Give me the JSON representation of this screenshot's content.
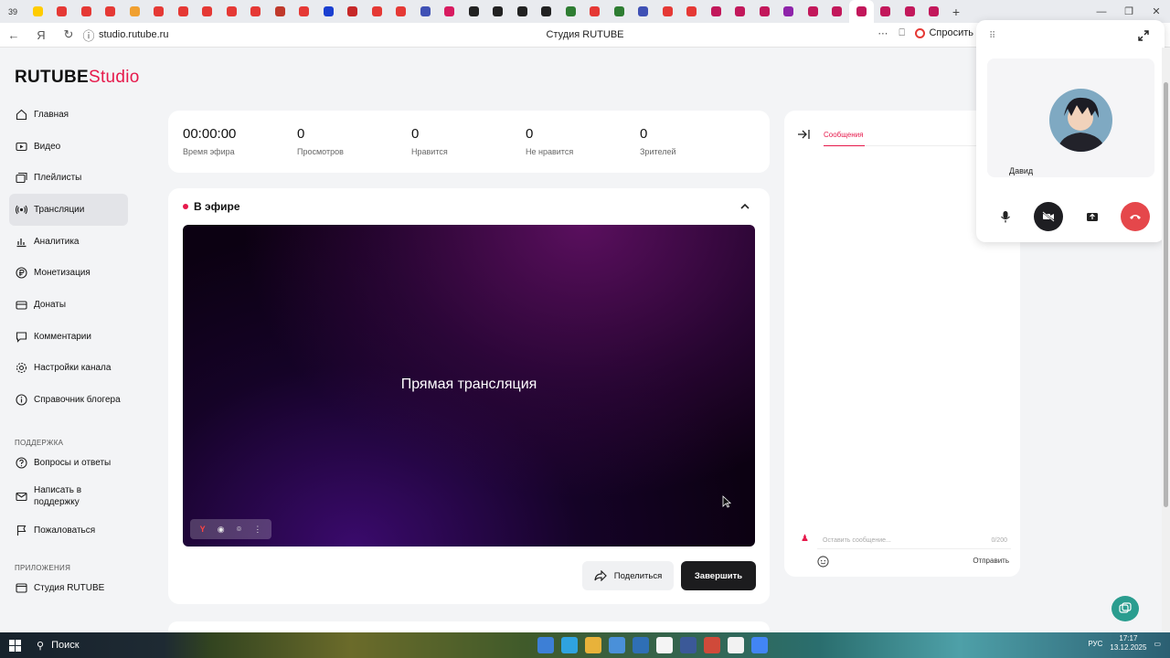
{
  "browser": {
    "tab_count": "39",
    "url": "studio.rutube.ru",
    "title": "Студия RUTUBE",
    "ask_label": "Спросить"
  },
  "logo": {
    "brand": "RUTUBE",
    "product": "Studio"
  },
  "sidebar": {
    "items": [
      {
        "label": "Главная",
        "icon": "home-icon"
      },
      {
        "label": "Видео",
        "icon": "video-icon"
      },
      {
        "label": "Плейлисты",
        "icon": "playlist-icon"
      },
      {
        "label": "Трансляции",
        "icon": "broadcast-icon",
        "active": true
      },
      {
        "label": "Аналитика",
        "icon": "analytics-icon"
      },
      {
        "label": "Монетизация",
        "icon": "ruble-icon"
      },
      {
        "label": "Донаты",
        "icon": "donation-icon"
      },
      {
        "label": "Комментарии",
        "icon": "comment-icon"
      },
      {
        "label": "Настройки канала",
        "icon": "gear-icon"
      },
      {
        "label": "Справочник блогера",
        "icon": "info-icon"
      }
    ],
    "support_title": "ПОДДЕРЖКА",
    "support_items": [
      {
        "label": "Вопросы и ответы",
        "icon": "question-icon"
      },
      {
        "label": "Написать в поддержку",
        "icon": "mail-icon"
      },
      {
        "label": "Пожаловаться",
        "icon": "flag-icon"
      }
    ],
    "apps_title": "ПРИЛОЖЕНИЯ",
    "apps_items": [
      {
        "label": "Студия RUTUBE",
        "icon": "app-icon"
      }
    ]
  },
  "stats": [
    {
      "value": "00:00:00",
      "label": "Время эфира"
    },
    {
      "value": "0",
      "label": "Просмотров"
    },
    {
      "value": "0",
      "label": "Нравится"
    },
    {
      "value": "0",
      "label": "Не нравится"
    },
    {
      "value": "0",
      "label": "Зрителей"
    }
  ],
  "live": {
    "status": "В эфире",
    "player_text": "Прямая трансляция",
    "share_label": "Поделиться",
    "end_label": "Завершить"
  },
  "chat": {
    "tab_messages": "Сообщения",
    "input_placeholder": "Оставить сообщение...",
    "char_count": "0/200",
    "send_label": "Отправить"
  },
  "call": {
    "caller_name": "Давид"
  },
  "taskbar": {
    "search_label": "Поиск",
    "lang": "РУС",
    "time": "17:17",
    "date": "13.12.2025"
  }
}
